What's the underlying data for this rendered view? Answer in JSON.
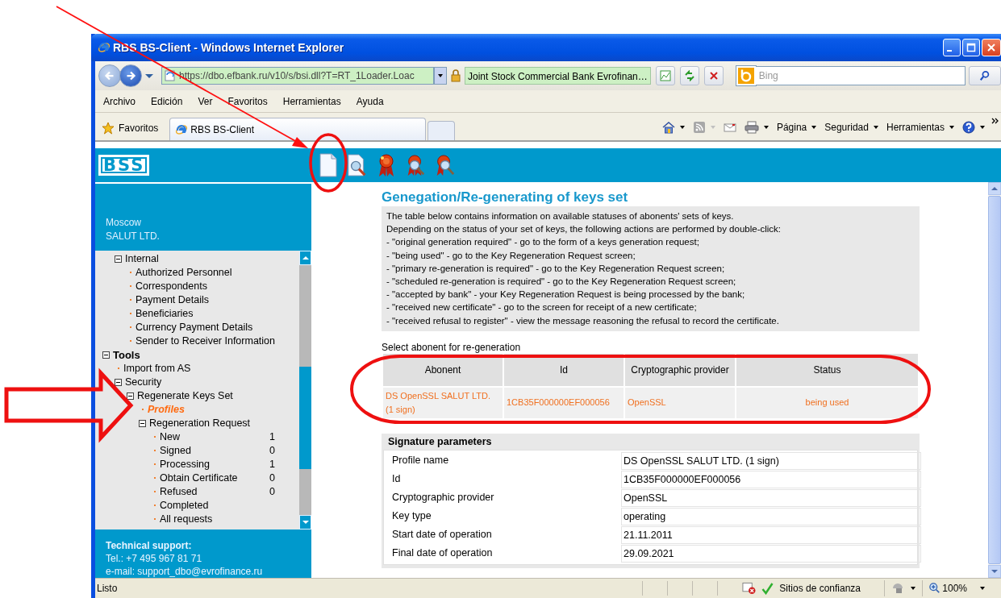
{
  "window": {
    "title": "RBS BS-Client - Windows Internet Explorer"
  },
  "address_bar": {
    "url": "https://dbo.efbank.ru/v10/s/bsi.dll?T=RT_1Loader.Loac",
    "site_identity": "Joint Stock Commercial Bank Evrofinan…"
  },
  "search": {
    "placeholder": "Bing"
  },
  "menu": [
    "Archivo",
    "Edición",
    "Ver",
    "Favoritos",
    "Herramientas",
    "Ayuda"
  ],
  "favorites": {
    "label": "Favoritos"
  },
  "tabs": [
    {
      "label": "RBS BS-Client",
      "selected": true
    }
  ],
  "command_bar": [
    "Página",
    "Seguridad",
    "Herramientas"
  ],
  "app": {
    "logo": "BSS"
  },
  "sidebar": {
    "location": [
      "Moscow",
      "SALUT LTD."
    ],
    "tree": [
      {
        "label": "Internal",
        "kind": "folder",
        "expanded": true,
        "children": [
          {
            "label": "Authorized Personnel",
            "kind": "leaf",
            "selected": false
          },
          {
            "label": "Correspondents",
            "kind": "leaf",
            "selected": false
          },
          {
            "label": "Payment Details",
            "kind": "leaf",
            "selected": false
          },
          {
            "label": "Beneficiaries",
            "kind": "leaf",
            "selected": false
          },
          {
            "label": "Currency Payment Details",
            "kind": "leaf",
            "selected": false
          },
          {
            "label": "Sender to Receiver Information",
            "kind": "leaf",
            "selected": false
          }
        ]
      },
      {
        "label": "Tools",
        "kind": "section",
        "expanded": true,
        "children": [
          {
            "label": "Import from AS",
            "kind": "leaf",
            "selected": false
          },
          {
            "label": "Security",
            "kind": "folder",
            "expanded": true,
            "children": [
              {
                "label": "Regenerate Keys Set",
                "kind": "folder",
                "expanded": true,
                "children": [
                  {
                    "label": "Profiles",
                    "kind": "leaf",
                    "selected": true
                  },
                  {
                    "label": "Regeneration Request",
                    "kind": "folder",
                    "expanded": true,
                    "children": [
                      {
                        "label": "New",
                        "kind": "leaf",
                        "selected": false,
                        "count": "1"
                      },
                      {
                        "label": "Signed",
                        "kind": "leaf",
                        "selected": false,
                        "count": "0"
                      },
                      {
                        "label": "Processing",
                        "kind": "leaf",
                        "selected": false,
                        "count": "1"
                      },
                      {
                        "label": "Obtain Certificate",
                        "kind": "leaf",
                        "selected": false,
                        "count": "0"
                      },
                      {
                        "label": "Refused",
                        "kind": "leaf",
                        "selected": false,
                        "count": "0"
                      },
                      {
                        "label": "Completed",
                        "kind": "leaf",
                        "selected": false
                      },
                      {
                        "label": "All requests",
                        "kind": "leaf",
                        "selected": false
                      }
                    ]
                  }
                ]
              }
            ]
          }
        ]
      }
    ],
    "support": {
      "title": "Technical support:",
      "lines": [
        "Tel.: +7 495 967 81 71",
        "e-mail: support_dbo@evrofinance.ru"
      ]
    }
  },
  "main": {
    "title": "Genegation/Re-generating of keys set",
    "info": [
      "The table below contains information on available statuses of abonents' sets of keys.",
      "Depending on the status of your set of keys, the following actions are performed by double-click:",
      "- \"original generation required\" - go to the form of a keys generation request;",
      "- \"being used\" - go to the Key Regeneration Request screen;",
      "- \"primary re-generation is required\" - go to the Key Regeneration Request screen;",
      "- \"scheduled re-generation is required\" - go to the Key Regeneration Request screen;",
      "- \"accepted by bank\" - your Key Regeneration Request is being processed by the bank;",
      "- \"received new certificate\" - go to the screen for receipt of a new certificate;",
      "- \"received refusal to register\" - view the message reasoning the refusal to record the certificate."
    ],
    "table_caption": "Select abonent for re-generation",
    "columns": [
      "Abonent",
      "Id",
      "Cryptographic provider",
      "Status"
    ],
    "rows": [
      {
        "cells": [
          "DS OpenSSL SALUT LTD. (1 sign)",
          "1CB35F000000EF000056",
          "OpenSSL",
          "being used"
        ],
        "selected": true
      }
    ],
    "signature": {
      "title": "Signature parameters",
      "params": [
        {
          "label": "Profile name",
          "value": "DS OpenSSL SALUT LTD. (1 sign)"
        },
        {
          "label": "Id",
          "value": "1CB35F000000EF000056"
        },
        {
          "label": "Cryptographic provider",
          "value": "OpenSSL"
        },
        {
          "label": "Key type",
          "value": "operating"
        },
        {
          "label": "Start date of operation",
          "value": "21.11.2011"
        },
        {
          "label": "Final date of operation",
          "value": "29.09.2021"
        }
      ]
    }
  },
  "status_bar": {
    "text": "Listo",
    "zone": "Sitios de confianza",
    "zoom": "100%"
  }
}
